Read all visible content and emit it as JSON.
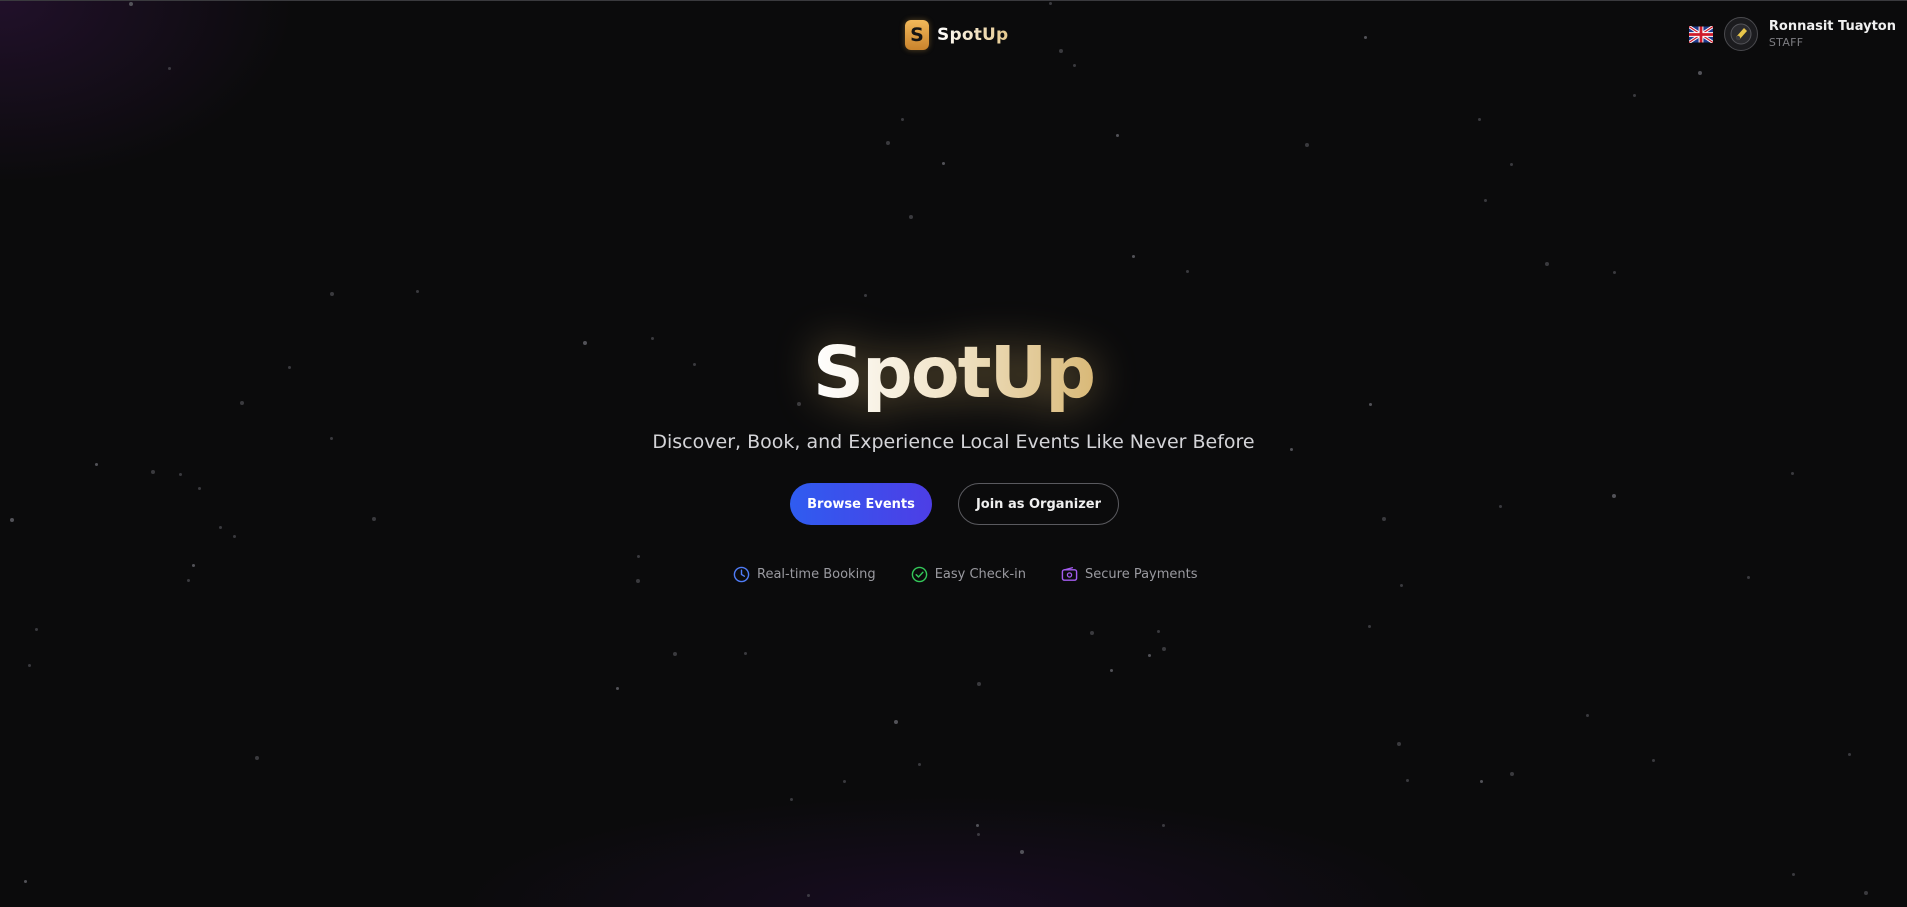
{
  "header": {
    "brand": "SpotUp",
    "logo_letter": "S",
    "language_flag": "uk-flag-icon",
    "user": {
      "name": "Ronnasit Tuayton",
      "role": "STAFF",
      "avatar_icon": "avatar-icon"
    }
  },
  "hero": {
    "title": "SpotUp",
    "subtitle": "Discover, Book, and Experience Local Events Like Never Before",
    "buttons": {
      "primary": "Browse Events",
      "secondary": "Join as Organizer"
    },
    "features": [
      {
        "label": "Real-time Booking",
        "icon": "clock-icon",
        "color": "#4f7cf7"
      },
      {
        "label": "Easy Check-in",
        "icon": "check-circle-icon",
        "color": "#34c759"
      },
      {
        "label": "Secure Payments",
        "icon": "wallet-icon",
        "color": "#a45cf0"
      }
    ]
  },
  "colors": {
    "background": "#0b0b0c",
    "accent_gold": "#d9b978",
    "primary_blue": "#2f5cf0",
    "primary_indigo": "#4d3ee6"
  }
}
